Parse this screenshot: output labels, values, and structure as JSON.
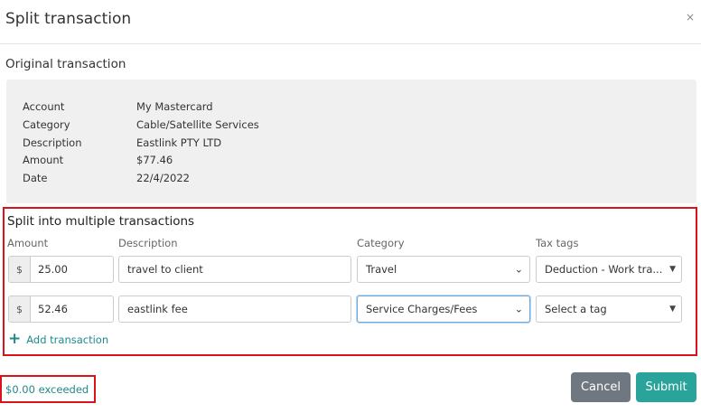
{
  "dialog": {
    "title": "Split transaction",
    "close_icon": "×"
  },
  "original": {
    "section_title": "Original transaction",
    "details": [
      {
        "label": "Account",
        "value": "My Mastercard"
      },
      {
        "label": "Category",
        "value": "Cable/Satellite Services"
      },
      {
        "label": "Description",
        "value": "Eastlink PTY LTD"
      },
      {
        "label": "Amount",
        "value": "$77.46"
      },
      {
        "label": "Date",
        "value": "22/4/2022"
      }
    ]
  },
  "split": {
    "section_title": "Split into multiple transactions",
    "headers": {
      "amount": "Amount",
      "description": "Description",
      "category": "Category",
      "tax_tags": "Tax tags"
    },
    "currency_symbol": "$",
    "rows": [
      {
        "amount": "25.00",
        "description": "travel to client",
        "category": "Travel",
        "tax_tag": "Deduction - Work tra..."
      },
      {
        "amount": "52.46",
        "description": "eastlink fee",
        "category": "Service Charges/Fees",
        "tax_tag": "Select a tag"
      }
    ],
    "add_label": "Add transaction",
    "add_icon": "+"
  },
  "footer": {
    "exceeded_text": "$0.00 exceeded",
    "cancel_label": "Cancel",
    "submit_label": "Submit"
  },
  "colors": {
    "teal_accent": "#2aa39a",
    "link_teal": "#1f8a8a",
    "highlight_red": "#d9121b",
    "cancel_gray": "#6f7880"
  }
}
